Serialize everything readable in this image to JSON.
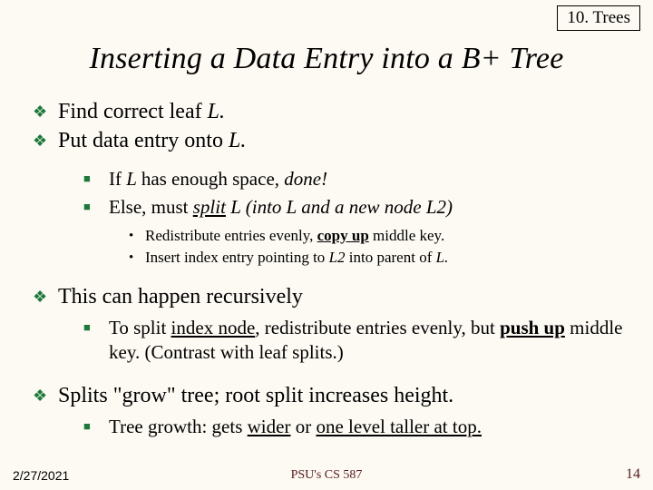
{
  "header": {
    "badge": "10. Trees"
  },
  "title": "Inserting a Data Entry into a B+ Tree",
  "b1": "Find correct leaf ",
  "b1_it": "L.",
  "b2a": "Put data entry onto ",
  "b2b": "L.",
  "s1a": "If ",
  "s1b": "L ",
  "s1c": "has enough space, ",
  "s1d": "done",
  "s1e": "!",
  "s2a": "Else, must ",
  "s2b": "split",
  "s2c": "  L (into L and a new node L2)",
  "t1a": "Redistribute entries evenly, ",
  "t1b": "copy up",
  "t1c": " middle key.",
  "t2a": "Insert index entry pointing to ",
  "t2b": "L2",
  "t2c": " into parent of ",
  "t2d": "L.",
  "b3": "This can happen recursively",
  "s3a": "To split ",
  "s3b": "index ",
  "s3c": "node",
  "s3d": ", redistribute entries evenly, but ",
  "s3e": "push up",
  "s3f": " middle key.  (Contrast with leaf splits.)",
  "b4": "Splits \"grow\" tree; root split increases height.",
  "s4a": "Tree growth: gets ",
  "s4b": "wider",
  "s4c": " or ",
  "s4d": "one level taller at top.",
  "footer": {
    "left": "2/27/2021",
    "center": "PSU's CS 587",
    "right": "14"
  }
}
